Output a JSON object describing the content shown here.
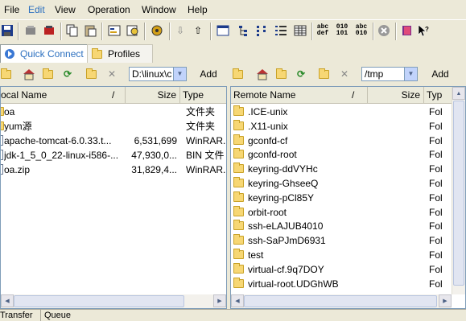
{
  "menu": {
    "items": [
      {
        "label": "File"
      },
      {
        "label": "Edit"
      },
      {
        "label": "View"
      },
      {
        "label": "Operation"
      },
      {
        "label": "Window"
      },
      {
        "label": "Help"
      }
    ]
  },
  "toolbar": {
    "icons": [
      "save-icon",
      "disconnect-icon",
      "connect-icon",
      "copy-icon",
      "paste-icon",
      "properties-icon",
      "find-icon",
      "settings-icon",
      "download-icon",
      "upload-icon",
      "view-icon",
      "tree-icon",
      "list-icon",
      "details-icon",
      "ascii-icon",
      "binary-icon",
      "auto-icon",
      "stop-icon",
      "book-icon",
      "help-cursor-icon"
    ],
    "ascii_label": "abc def",
    "binary_label": "010 101",
    "auto_label": "abc 010"
  },
  "tabs": [
    {
      "label": "Quick Connect",
      "active": true
    },
    {
      "label": "Profiles",
      "active": false
    }
  ],
  "local": {
    "path": "D:\\linux\\c",
    "add_label": "Add",
    "columns": [
      "ocal Name",
      "Size",
      "Type"
    ],
    "sort_indicator": "/",
    "rows": [
      {
        "name": "oa",
        "size": "",
        "type": "文件夹",
        "kind": "folder"
      },
      {
        "name": "yum源",
        "size": "",
        "type": "文件夹",
        "kind": "folder"
      },
      {
        "name": "apache-tomcat-6.0.33.t...",
        "size": "6,531,699",
        "type": "WinRAR...",
        "kind": "file"
      },
      {
        "name": "jdk-1_5_0_22-linux-i586-...",
        "size": "47,930,0...",
        "type": "BIN 文件",
        "kind": "file"
      },
      {
        "name": "oa.zip",
        "size": "31,829,4...",
        "type": "WinRAR...",
        "kind": "file"
      }
    ]
  },
  "remote": {
    "path": "/tmp",
    "add_label": "Add",
    "columns": [
      "Remote Name",
      "Size",
      "Typ"
    ],
    "sort_indicator": "/",
    "rows": [
      {
        "name": ".ICE-unix",
        "type": "Fol"
      },
      {
        "name": ".X11-unix",
        "type": "Fol"
      },
      {
        "name": "gconfd-cf",
        "type": "Fol"
      },
      {
        "name": "gconfd-root",
        "type": "Fol"
      },
      {
        "name": "keyring-ddVYHc",
        "type": "Fol"
      },
      {
        "name": "keyring-GhseeQ",
        "type": "Fol"
      },
      {
        "name": "keyring-pCl85Y",
        "type": "Fol"
      },
      {
        "name": "orbit-root",
        "type": "Fol"
      },
      {
        "name": "ssh-eLAJUB4010",
        "type": "Fol"
      },
      {
        "name": "ssh-SaPJmD6931",
        "type": "Fol"
      },
      {
        "name": "test",
        "type": "Fol"
      },
      {
        "name": "virtual-cf.9q7DOY",
        "type": "Fol"
      },
      {
        "name": "virtual-root.UDGhWB",
        "type": "Fol"
      }
    ]
  },
  "bottom_tabs": [
    {
      "label": "Transfer"
    },
    {
      "label": "Queue"
    }
  ],
  "colors": {
    "accent": "#2b6fbf",
    "folder": "#f7d774",
    "chrome": "#ece9d8"
  }
}
